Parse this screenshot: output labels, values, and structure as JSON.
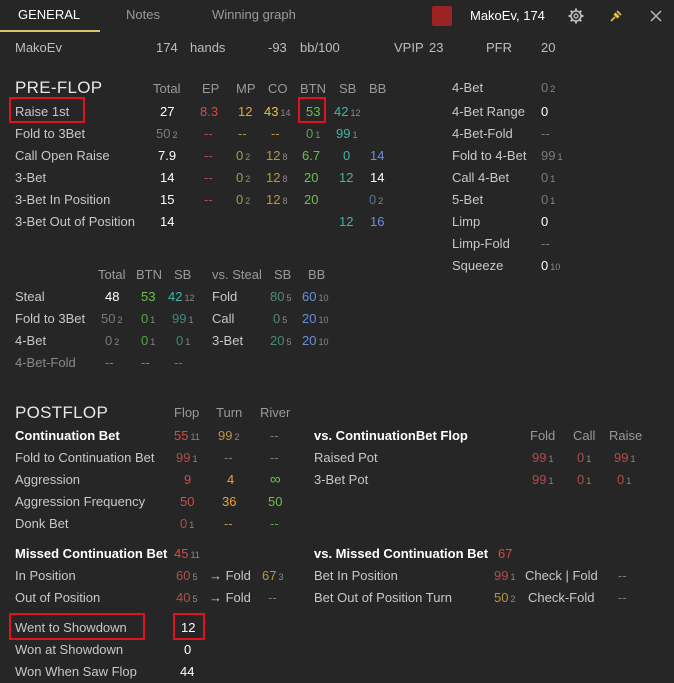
{
  "tabs": [
    "GENERAL",
    "Notes",
    "Winning graph"
  ],
  "player": {
    "name": "MakoEv, 174"
  },
  "summary": {
    "name": "MakoEv",
    "hands_count": "174",
    "hands_label": "hands",
    "bb100_value": "-93",
    "bb100_label": "bb/100",
    "vpip_label": "VPIP",
    "vpip_value": "23",
    "pfr_label": "PFR",
    "pfr_value": "20"
  },
  "preflop": {
    "title": "PRE-FLOP",
    "headers": [
      "Total",
      "EP",
      "MP",
      "CO",
      "BTN",
      "SB",
      "BB"
    ],
    "rows": [
      {
        "label": "Raise 1st",
        "total": "27",
        "ep": "8.3",
        "mp": "12",
        "co": "43",
        "co_sub": "14",
        "btn": "53",
        "sb": "42",
        "sb_sub": "12",
        "bb": ""
      },
      {
        "label": "Fold to 3Bet",
        "total": "50",
        "total_sub": "2",
        "ep": "--",
        "mp": "--",
        "co": "--",
        "btn": "0",
        "btn_sub": "1",
        "sb": "99",
        "sb_sub": "1",
        "bb": ""
      },
      {
        "label": "Call Open Raise",
        "total": "7.9",
        "ep": "--",
        "mp": "0",
        "mp_sub": "2",
        "co": "12",
        "co_sub": "8",
        "btn": "6.7",
        "sb": "0",
        "bb": "14"
      },
      {
        "label": "3-Bet",
        "total": "14",
        "ep": "--",
        "mp": "0",
        "mp_sub": "2",
        "co": "12",
        "co_sub": "8",
        "btn": "20",
        "sb": "12",
        "bb": "14"
      },
      {
        "label": "3-Bet In Position",
        "total": "15",
        "ep": "--",
        "mp": "0",
        "mp_sub": "2",
        "co": "12",
        "co_sub": "8",
        "btn": "20",
        "sb": "",
        "bb": "0",
        "bb_sub": "2"
      },
      {
        "label": "3-Bet Out of Position",
        "total": "14",
        "ep": "",
        "mp": "",
        "co": "",
        "btn": "",
        "sb": "12",
        "bb": "16"
      }
    ],
    "right": [
      {
        "label": "4-Bet",
        "value": "0",
        "sub": "2"
      },
      {
        "label": "4-Bet Range",
        "value": "0",
        "sub": ""
      },
      {
        "label": "4-Bet-Fold",
        "value": "--",
        "sub": ""
      },
      {
        "label": "Fold to 4-Bet",
        "value": "99",
        "sub": "1"
      },
      {
        "label": "Call 4-Bet",
        "value": "0",
        "sub": "1"
      },
      {
        "label": "5-Bet",
        "value": "0",
        "sub": "1"
      },
      {
        "label": "Limp",
        "value": "0",
        "sub": ""
      },
      {
        "label": "Limp-Fold",
        "value": "--",
        "sub": ""
      },
      {
        "label": "Squeeze",
        "value": "0",
        "sub": "10"
      }
    ]
  },
  "steal": {
    "headers": [
      "Total",
      "BTN",
      "SB"
    ],
    "vs_headers": [
      "vs. Steal",
      "SB",
      "BB"
    ],
    "rows": [
      {
        "label": "Steal",
        "total": "48",
        "btn": "53",
        "sb": "42",
        "sb_sub": "12"
      },
      {
        "label": "Fold to 3Bet",
        "total": "50",
        "total_sub": "2",
        "btn": "0",
        "btn_sub": "1",
        "sb": "99",
        "sb_sub": "1"
      },
      {
        "label": "4-Bet",
        "total": "0",
        "total_sub": "2",
        "btn": "0",
        "btn_sub": "1",
        "sb": "0",
        "sb_sub": "1"
      },
      {
        "label": "4-Bet-Fold",
        "total": "--",
        "btn": "--",
        "sb": "--"
      }
    ],
    "vs_rows": [
      {
        "label": "Fold",
        "sb": "80",
        "sb_sub": "5",
        "bb": "60",
        "bb_sub": "10"
      },
      {
        "label": "Call",
        "sb": "0",
        "sb_sub": "5",
        "bb": "20",
        "bb_sub": "10"
      },
      {
        "label": "3-Bet",
        "sb": "20",
        "sb_sub": "5",
        "bb": "20",
        "bb_sub": "10"
      }
    ]
  },
  "postflop": {
    "title": "POSTFLOP",
    "headers": [
      "Flop",
      "Turn",
      "River"
    ],
    "rows": [
      {
        "label": "Continuation Bet",
        "flop": "55",
        "flop_sub": "11",
        "turn": "99",
        "turn_sub": "2",
        "river": "--"
      },
      {
        "label": "Fold to Continuation Bet",
        "flop": "99",
        "flop_sub": "1",
        "turn": "--",
        "river": "--"
      },
      {
        "label": "Aggression",
        "flop": "9",
        "turn": "4",
        "river": "∞"
      },
      {
        "label": "Aggression Frequency",
        "flop": "50",
        "turn": "36",
        "river": "50"
      },
      {
        "label": "Donk Bet",
        "flop": "0",
        "flop_sub": "1",
        "turn": "--",
        "river": "--"
      }
    ],
    "vs_cbet": {
      "title": "vs. ContinuationBet Flop",
      "headers": [
        "Fold",
        "Call",
        "Raise"
      ],
      "rows": [
        {
          "label": "Raised Pot",
          "fold": "99",
          "fold_sub": "1",
          "call": "0",
          "call_sub": "1",
          "raise": "99",
          "raise_sub": "1"
        },
        {
          "label": "3-Bet Pot",
          "fold": "99",
          "fold_sub": "1",
          "call": "0",
          "call_sub": "1",
          "raise": "0",
          "raise_sub": "1"
        }
      ]
    },
    "missed": {
      "label": "Missed Continuation Bet",
      "value": "45",
      "value_sub": "11",
      "in_position": {
        "label": "In Position",
        "value": "60",
        "sub": "5",
        "arrow": "→ Fold",
        "fold_value": "67",
        "fold_sub": "3"
      },
      "out_of_position": {
        "label": "Out of Position",
        "value": "40",
        "sub": "5",
        "arrow": "→ Fold",
        "fold_value": "--"
      }
    },
    "vs_missed": {
      "label": "vs. Missed Continuation Bet",
      "value": "67",
      "bet_in_position": {
        "label": "Bet In Position",
        "value": "99",
        "sub": "1",
        "action": "Check | Fold",
        "action_value": "--"
      },
      "bet_oop_turn": {
        "label": "Bet Out of Position Turn",
        "value": "50",
        "sub": "2",
        "action": "Check-Fold",
        "action_value": "--"
      }
    },
    "showdown": [
      {
        "label": "Went to Showdown",
        "value": "12"
      },
      {
        "label": "Won at Showdown",
        "value": "0"
      },
      {
        "label": "Won When Saw Flop",
        "value": "44"
      }
    ]
  },
  "colors": {
    "accent_underline": "#d8c36a",
    "swatch": "#9b2323",
    "highlight_box": "#e0141e",
    "pin": "#e6c244"
  }
}
